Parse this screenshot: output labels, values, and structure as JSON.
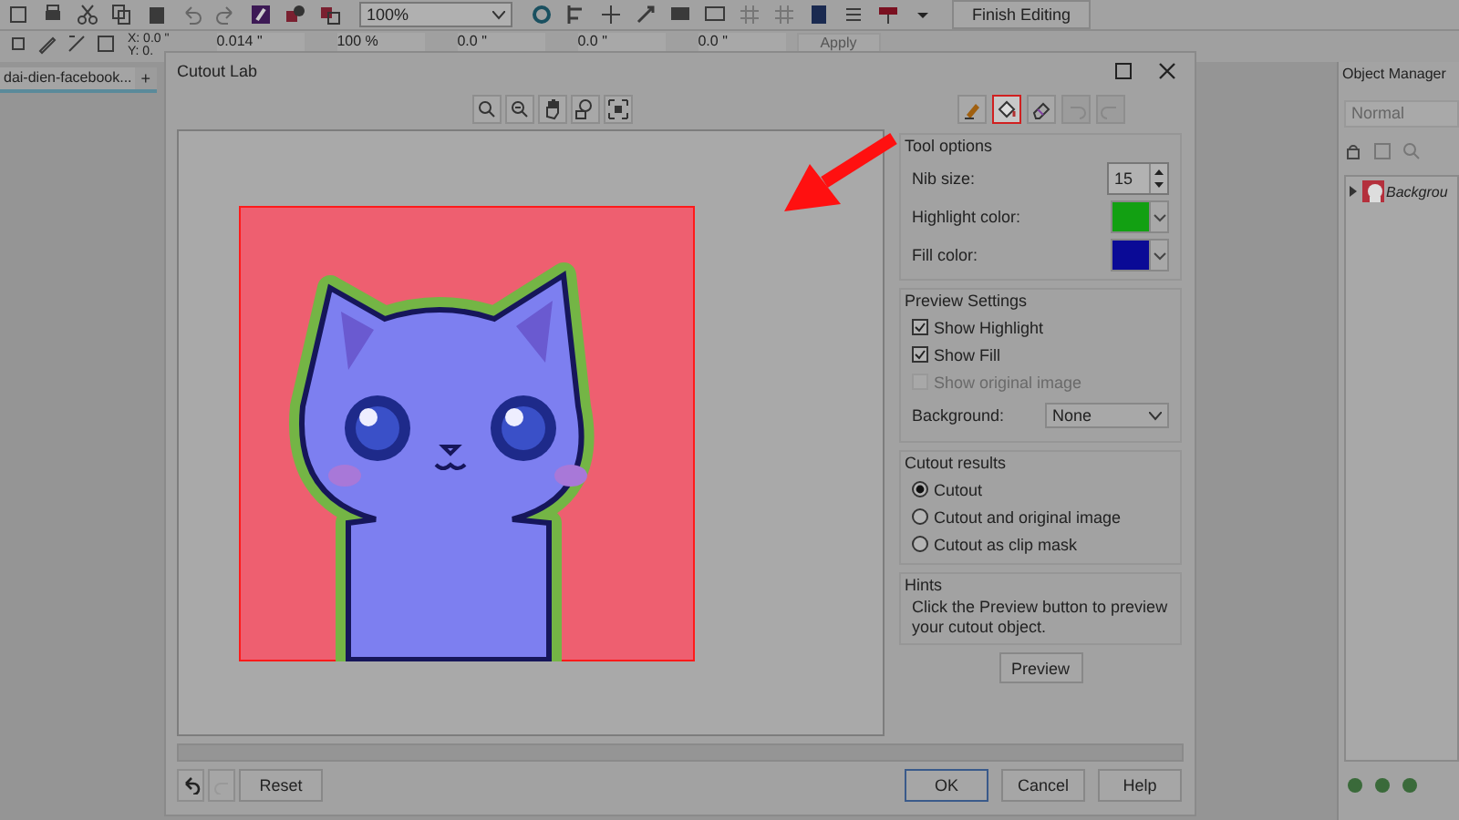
{
  "toolbar": {
    "zoom": "100%",
    "finish_button": "Finish Editing"
  },
  "property_bar": {
    "x": "X: 0.0 \"",
    "y": "Y: 0.",
    "fields": [
      "0.014 \"",
      "100 %",
      "0.0 \"",
      "0.0 \"",
      "0.0 \""
    ],
    "apply": {
      "label": "Apply",
      "disabled": true
    }
  },
  "document_tab": {
    "label": "dai-dien-facebook...",
    "add": "+"
  },
  "dialog": {
    "title": "Cutout Lab",
    "tools": [
      {
        "kind": "highlighter",
        "selected": false
      },
      {
        "kind": "fill",
        "selected": true
      },
      {
        "kind": "eraser",
        "selected": false
      }
    ],
    "tool_options": {
      "title": "Tool options",
      "nib_size": {
        "label": "Nib size:",
        "value": "15"
      },
      "highlight_color": {
        "label": "Highlight color:",
        "color": "#12a012"
      },
      "fill_color": {
        "label": "Fill color:",
        "color": "#0a0a96"
      }
    },
    "preview_settings": {
      "title": "Preview Settings",
      "options": [
        {
          "label": "Show Highlight",
          "checked": true,
          "disabled": false
        },
        {
          "label": "Show Fill",
          "checked": true,
          "disabled": false
        },
        {
          "label": "Show original image",
          "checked": false,
          "disabled": true
        }
      ],
      "background": {
        "label": "Background:",
        "value": "None"
      }
    },
    "cutout_results": {
      "title": "Cutout results",
      "options": [
        {
          "label": "Cutout",
          "selected": true
        },
        {
          "label": "Cutout and original image",
          "selected": false
        },
        {
          "label": "Cutout as clip mask",
          "selected": false
        }
      ]
    },
    "hints": {
      "title": "Hints",
      "text": "Click the Preview button to preview your cutout object."
    },
    "preview_button": "Preview",
    "progress": {
      "level": 0
    },
    "reset_button": "Reset",
    "buttons": [
      {
        "label": "OK",
        "default": true
      },
      {
        "label": "Cancel",
        "default": false
      },
      {
        "label": "Help",
        "default": false
      }
    ]
  },
  "object_manager": {
    "title": "Object Manager",
    "mode": "Normal",
    "items": [
      {
        "label": "Backgrou",
        "expanded": false
      }
    ]
  }
}
